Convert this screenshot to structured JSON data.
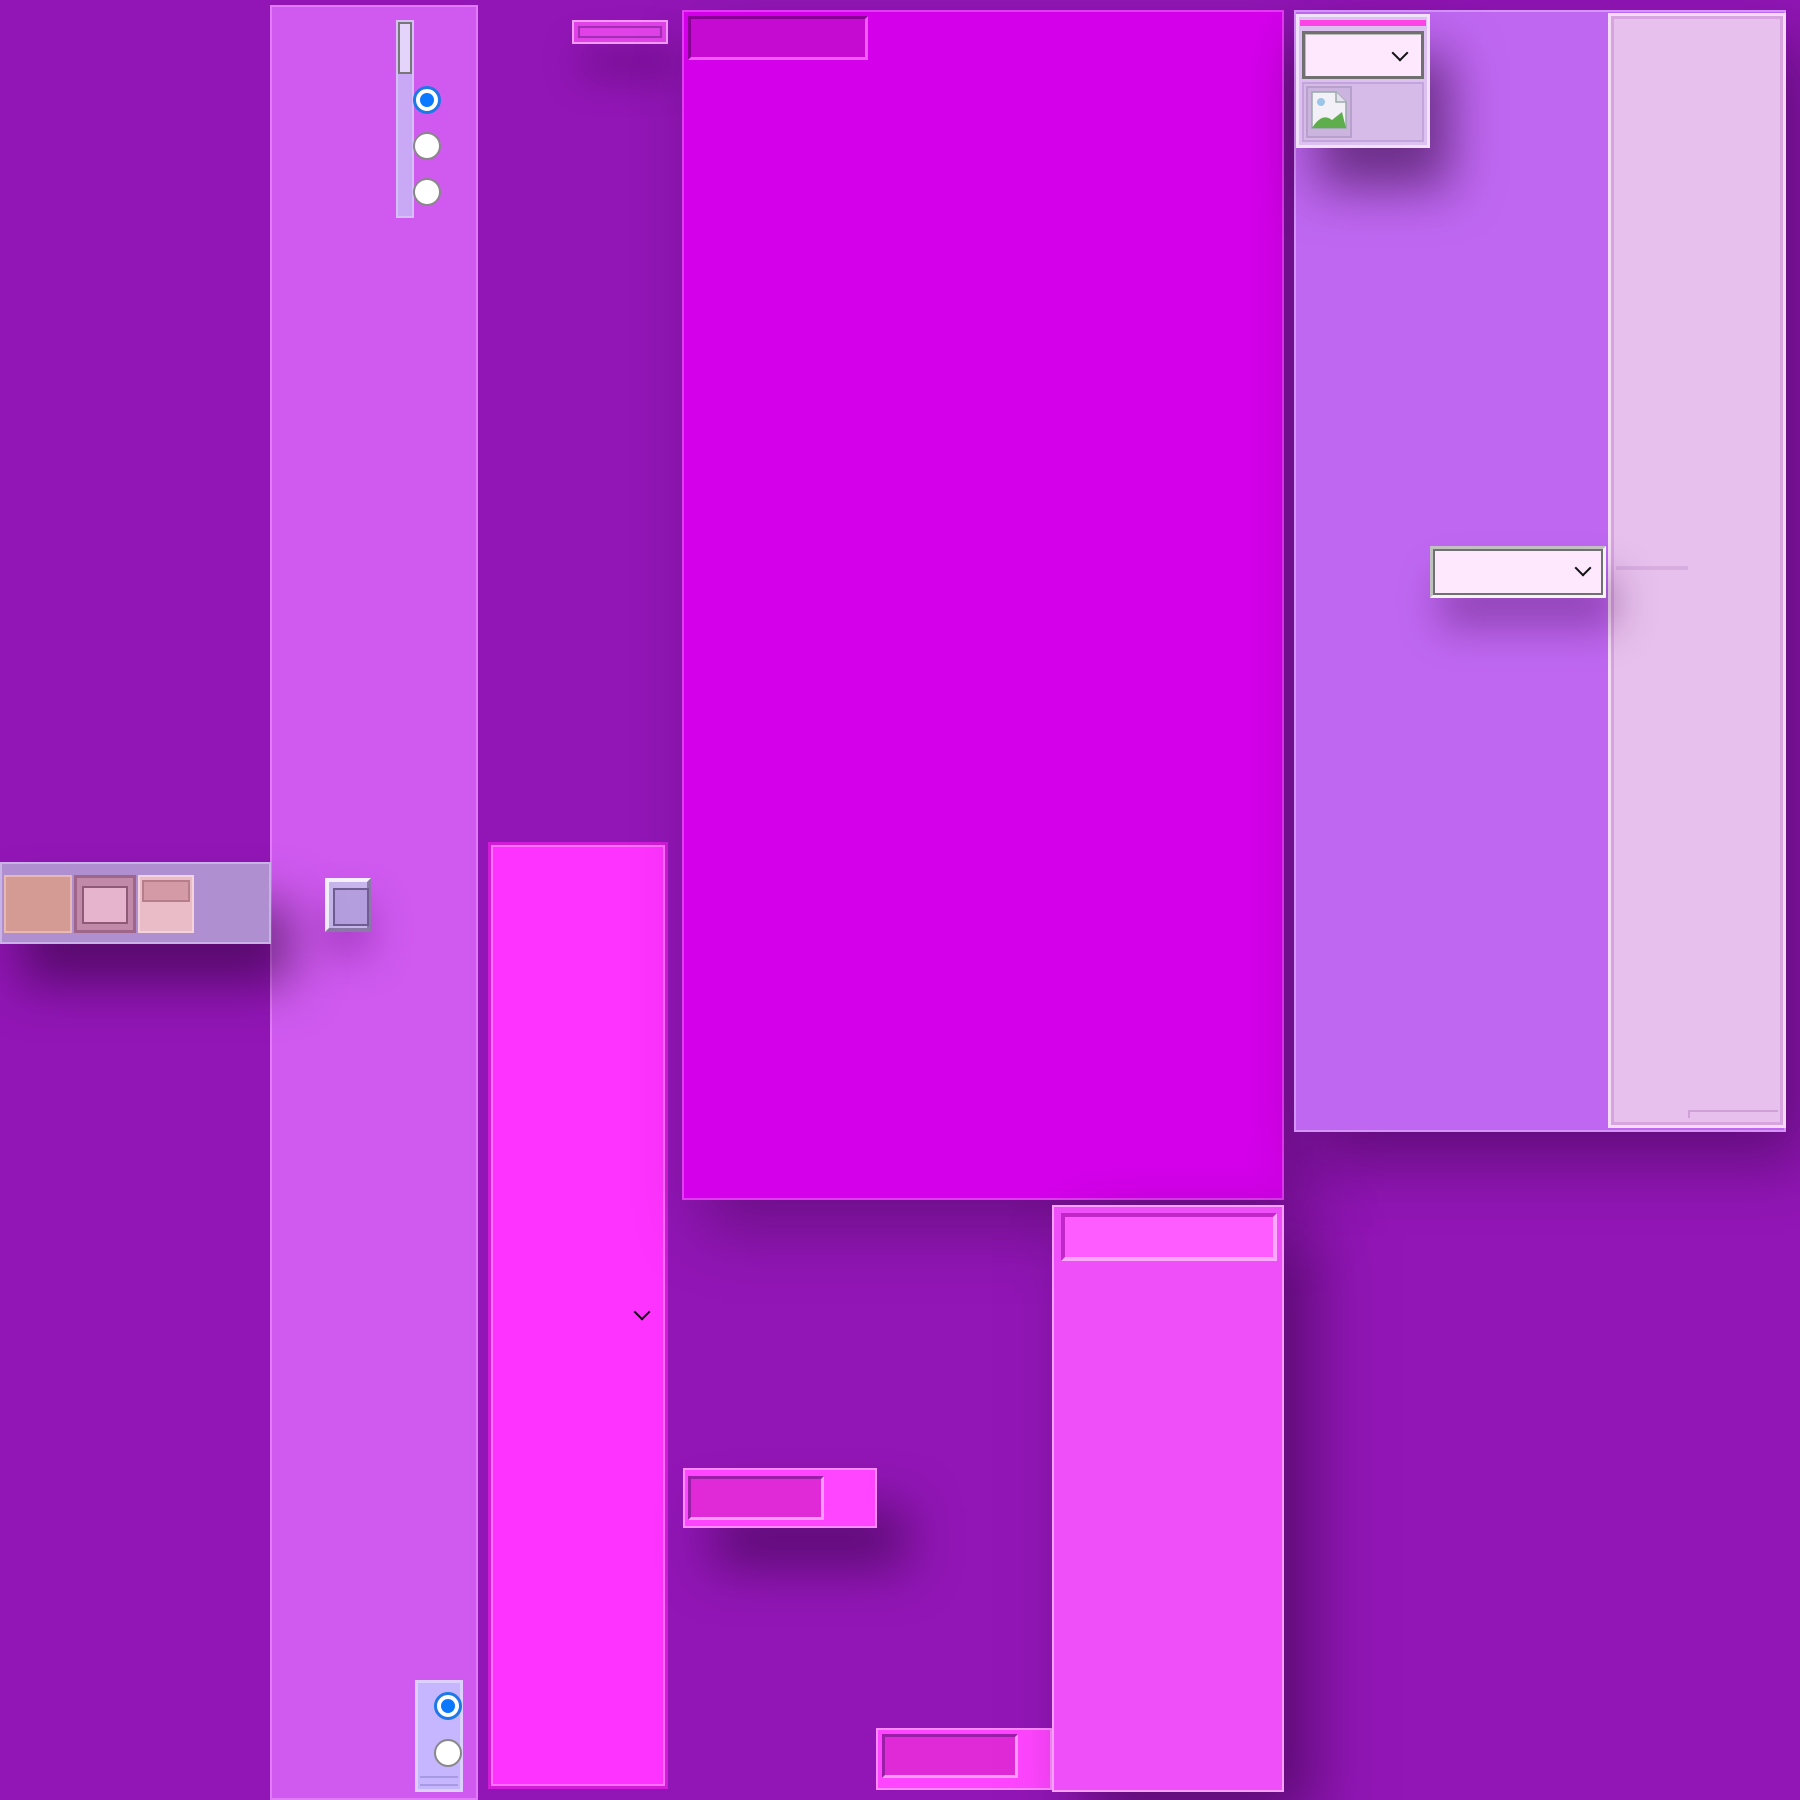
{
  "theme": {
    "background": "#9216b6",
    "accent": "#0a78ff",
    "panel_light_violet": "#d05af0",
    "panel_magenta": "#d400ea",
    "panel_pink": "#ff33ff",
    "panel_lavender": "#bf67f1",
    "panel_pale": "#e8c0ee"
  },
  "radio_group_top": {
    "options": [
      {
        "selected": true
      },
      {
        "selected": false
      },
      {
        "selected": false
      }
    ]
  },
  "radio_group_bottom": {
    "options": [
      {
        "selected": true
      },
      {
        "selected": false
      }
    ]
  },
  "icons": {
    "image": "broken-image-icon",
    "dropdown": "chevron-down-icon"
  }
}
